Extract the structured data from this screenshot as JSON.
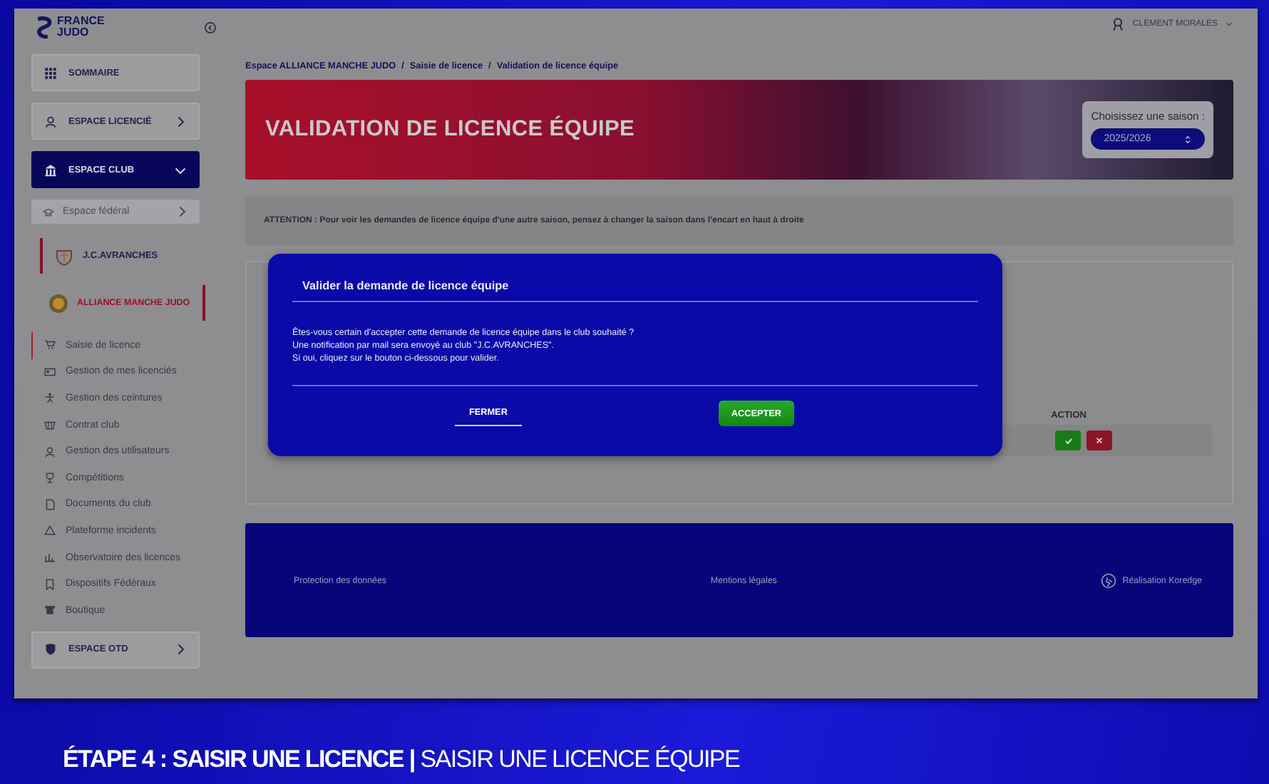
{
  "logo": {
    "line1": "FRANCE",
    "line2": "JUDO"
  },
  "user": {
    "name": "CLEMENT MORALES"
  },
  "sidebar": {
    "items": [
      {
        "kind": "link",
        "label": "SOMMAIRE"
      },
      {
        "kind": "section",
        "label": "ESPACE LICENCIÉ",
        "expanded": false
      },
      {
        "kind": "section",
        "label": "ESPACE CLUB",
        "expanded": true,
        "children": [
          {
            "kind": "subsection",
            "label": "Espace fédéral"
          },
          {
            "kind": "club",
            "label": "J.C.AVRANCHES",
            "selected": false
          },
          {
            "kind": "club",
            "label": "ALLIANCE MANCHE JUDO",
            "selected": true
          },
          {
            "kind": "menu",
            "label": "Saisie de licence",
            "selected": true
          },
          {
            "kind": "menu",
            "label": "Gestion de mes licenciés",
            "selected": false
          },
          {
            "kind": "menu",
            "label": "Gestion des ceintures",
            "selected": false
          },
          {
            "kind": "menu",
            "label": "Contrat club",
            "selected": false
          },
          {
            "kind": "menu",
            "label": "Gestion des utilisateurs",
            "selected": false
          },
          {
            "kind": "menu",
            "label": "Compétitions",
            "selected": false
          },
          {
            "kind": "menu",
            "label": "Documents du club",
            "selected": false
          },
          {
            "kind": "menu",
            "label": "Plateforme incidents",
            "selected": false
          },
          {
            "kind": "menu",
            "label": "Observatoire des licences",
            "selected": false
          },
          {
            "kind": "menu",
            "label": "Dispositifs Fédéraux",
            "selected": false
          },
          {
            "kind": "menu",
            "label": "Boutique",
            "selected": false
          }
        ]
      },
      {
        "kind": "section",
        "label": "ESPACE OTD",
        "expanded": false
      }
    ]
  },
  "breadcrumb": [
    "Espace ALLIANCE MANCHE JUDO",
    "/",
    "Saisie de licence",
    "/",
    "Validation de licence équipe"
  ],
  "banner": {
    "title": "VALIDATION DE LICENCE ÉQUIPE",
    "season_label": "Choisissez une saison :",
    "season_value": "2025/2026"
  },
  "attention": "ATTENTION : Pour voir les demandes de licence équipe d'une autre saison, pensez à changer la saison dans l'encart en haut à droite",
  "table": {
    "columns": [
      "ACTION"
    ]
  },
  "footer": {
    "links": [
      "Protection des données",
      "Mentions légales",
      "Réalisation Koredge"
    ]
  },
  "modal": {
    "title": "Valider la demande de licence équipe",
    "lines": [
      "Êtes-vous certain d'accepter cette demande de licence équipe dans le club souhaité ?",
      "Une notification par mail sera envoyé au club \"J.C.AVRANCHES\".",
      "Si oui, cliquez sur le bouton ci-dessous pour valider."
    ],
    "buttons": [
      {
        "kind": "secondary",
        "label": "FERMER"
      },
      {
        "kind": "primary",
        "label": "ACCEPTER"
      }
    ]
  },
  "caption": "**ÉTAPE 4 : SAISIR UNE LICENCE |** SAISIR UNE LICENCE ÉQUIPE"
}
